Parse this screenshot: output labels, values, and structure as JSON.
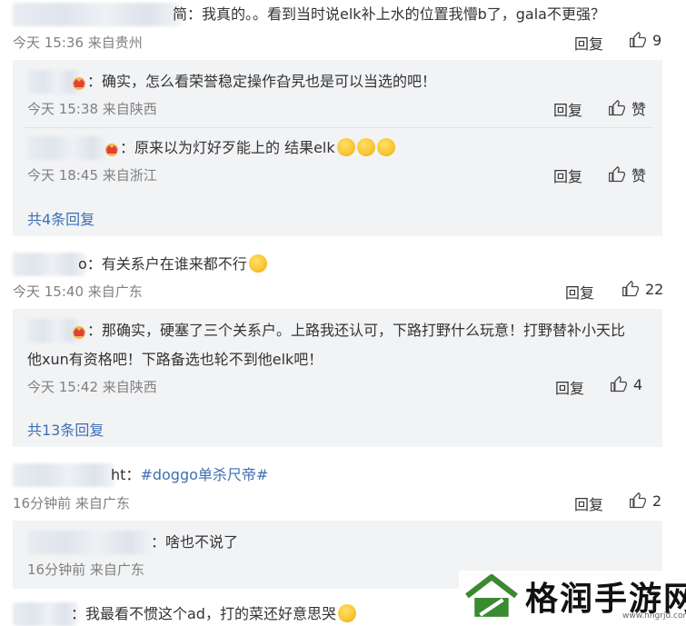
{
  "comments": [
    {
      "text_after_name": "：我真的。。看到当时说elk补上水的位置我懵b了，gala不更强？",
      "name_tail": "简",
      "meta": "今天 15:36 来自贵州",
      "reply_label": "回复",
      "likes": "9"
    },
    {
      "text_after_name": "：有关系户在谁来都不行",
      "name_tail": "ο",
      "meta": "今天 15:40 来自广东",
      "reply_label": "回复",
      "likes": "22"
    },
    {
      "name_tail": "ht",
      "text_after_name": "：",
      "hashtag": "#doggo单杀尺帝#",
      "meta": "16分钟前 来自广东",
      "reply_label": "回复",
      "likes": "2"
    },
    {
      "text_after_name": "：我最看不惯这个ad，打的菜还好意思哭"
    }
  ],
  "replies_group1": [
    {
      "text": "：确实，怎么看荣誉稳定操作旮旯也是可以当选的吧！",
      "meta": "今天 15:38 来自陕西",
      "reply_label": "回复",
      "like_label": "赞"
    },
    {
      "text": "：原来以为灯好歹能上的 结果elk",
      "meta": "今天 18:45 来自浙江",
      "reply_label": "回复",
      "like_label": "赞"
    }
  ],
  "more_replies_1": "共4条回复",
  "replies_group2": [
    {
      "text_line1": "：那确实，硬塞了三个关系户。上路我还认可，下路打野什么玩意！打野替补小天比",
      "text_line2": "他xun有资格吧！下路备选也轮不到他elk吧！",
      "meta": "今天 15:42 来自陕西",
      "reply_label": "回复",
      "likes": "4"
    }
  ],
  "more_replies_2": "共13条回复",
  "replies_group3": [
    {
      "text": "：啥也不说了",
      "meta": "16分钟前 来自广东"
    }
  ],
  "watermark": {
    "title": "格润手游网",
    "url": "www.hngrjd.com"
  },
  "colors": {
    "link": "#3d6fb5",
    "meta": "#808080",
    "reply_bg": "#f2f3f5",
    "logo_green": "#3a8a2f"
  }
}
